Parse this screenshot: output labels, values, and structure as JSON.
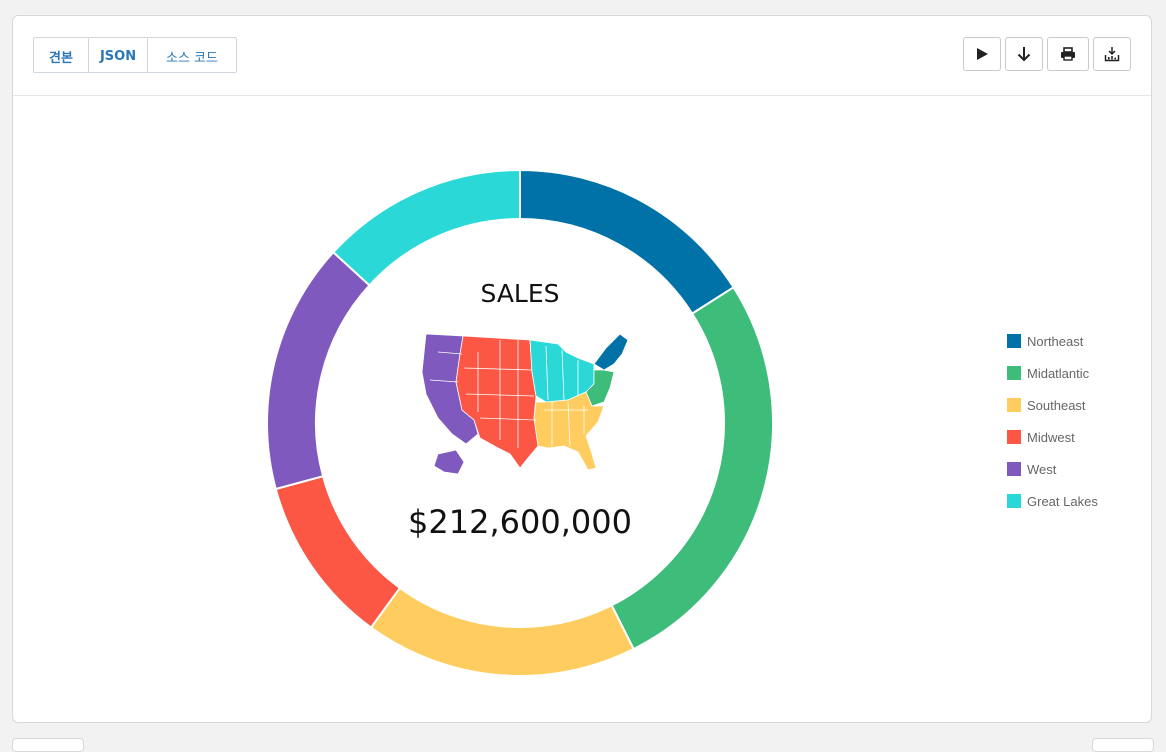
{
  "tabs": [
    {
      "label": "견본"
    },
    {
      "label": "JSON"
    },
    {
      "label": "소스 코드"
    }
  ],
  "toolbar": {
    "buttons": [
      {
        "icon": "play-icon"
      },
      {
        "icon": "download-arrow-icon"
      },
      {
        "icon": "print-icon"
      },
      {
        "icon": "export-icon"
      }
    ]
  },
  "chart_data": {
    "type": "pie",
    "subtype": "donut",
    "center_title": "SALES",
    "center_value": "$212,600,000",
    "categories": [
      "Northeast",
      "Midatlantic",
      "Southeast",
      "Midwest",
      "West",
      "Great Lakes"
    ],
    "values": [
      35.6,
      59.2,
      38.8,
      24.0,
      35.6,
      29.4
    ],
    "colors": [
      "#0072a7",
      "#3ebc79",
      "#ffcd5f",
      "#fc5644",
      "#7f59bd",
      "#2ad8d8"
    ],
    "legend": {
      "position": "right"
    }
  }
}
